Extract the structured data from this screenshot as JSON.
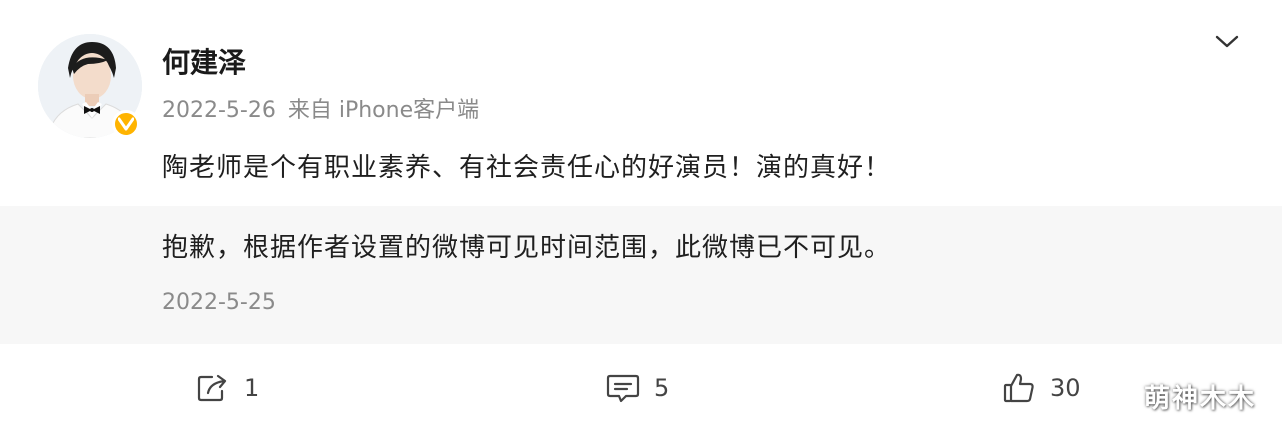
{
  "post": {
    "username": "何建泽",
    "date": "2022-5-26",
    "source": "来自 iPhone客户端",
    "text": "陶老师是个有职业素养、有社会责任心的好演员！演的真好！",
    "verified_color": "#ffb400"
  },
  "retweet": {
    "text": "抱歉，根据作者设置的微博可见时间范围，此微博已不可见。",
    "date": "2022-5-25"
  },
  "actions": {
    "share": {
      "icon": "share-icon",
      "count": "1"
    },
    "comment": {
      "icon": "comment-icon",
      "count": "5"
    },
    "like": {
      "icon": "thumbs-up-icon",
      "count": "30"
    }
  },
  "watermark": "萌神木木"
}
